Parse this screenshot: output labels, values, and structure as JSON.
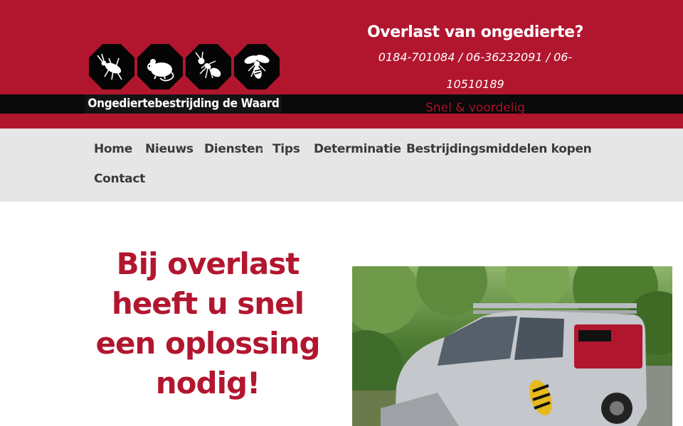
{
  "header": {
    "logo_text": "Ongediertebestrijding de Waard",
    "logo_icons": [
      "beetle-icon",
      "mouse-icon",
      "ant-icon",
      "wasp-icon"
    ],
    "tagline_title": "Overlast van ongedierte?",
    "tagline_phones": "0184-701084 / 06-36232091 / 06-10510189",
    "tagline_sub": "Snel & voordelig"
  },
  "nav": {
    "items": [
      {
        "label": "Home"
      },
      {
        "label": "Nieuws"
      },
      {
        "label": "Diensten"
      },
      {
        "label": "Tips"
      },
      {
        "label": "Determinatie"
      },
      {
        "label": "Bestrijdingsmiddelen kopen"
      },
      {
        "label": "Contact"
      }
    ]
  },
  "main": {
    "heading": "Bij overlast heeft u snel een oplossing nodig!"
  },
  "colors": {
    "brand_red": "#b2162f",
    "nav_bg": "#e6e6e6",
    "black_band": "#0a0a0a"
  }
}
